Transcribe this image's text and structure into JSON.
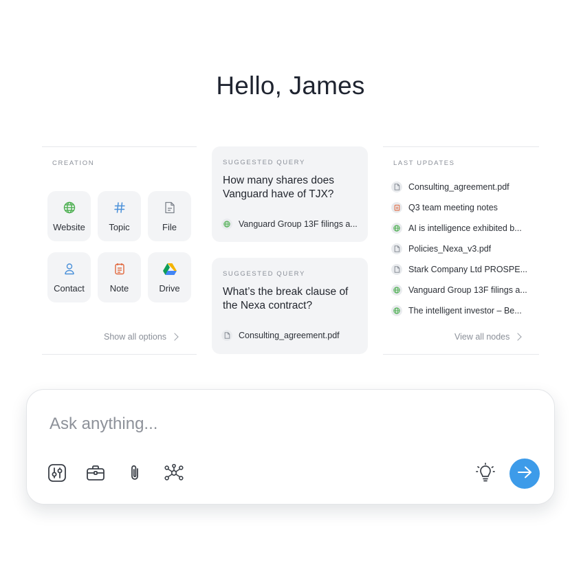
{
  "greeting": "Hello, James",
  "creation": {
    "label": "CREATION",
    "tiles": [
      {
        "label": "Website",
        "icon": "globe-icon"
      },
      {
        "label": "Topic",
        "icon": "hash-icon"
      },
      {
        "label": "File",
        "icon": "file-icon"
      },
      {
        "label": "Contact",
        "icon": "user-icon"
      },
      {
        "label": "Note",
        "icon": "note-icon"
      },
      {
        "label": "Drive",
        "icon": "google-drive-icon"
      }
    ],
    "show_all": "Show all options"
  },
  "suggested": [
    {
      "label": "SUGGESTED QUERY",
      "question": "How many shares does Vanguard have of TJX?",
      "source": "Vanguard Group 13F filings a...",
      "source_icon": "globe-icon"
    },
    {
      "label": "SUGGESTED QUERY",
      "question": "What’s the break clause of the Nexa contract?",
      "source": "Consulting_agreement.pdf",
      "source_icon": "file-icon"
    }
  ],
  "updates": {
    "label": "LAST UPDATES",
    "items": [
      {
        "text": "Consulting_agreement.pdf",
        "icon": "file-icon"
      },
      {
        "text": "Q3 team meeting notes",
        "icon": "note-icon"
      },
      {
        "text": "AI is intelligence exhibited b...",
        "icon": "globe-icon"
      },
      {
        "text": "Policies_Nexa_v3.pdf",
        "icon": "file-icon"
      },
      {
        "text": "Stark Company Ltd PROSPE...",
        "icon": "file-icon"
      },
      {
        "text": "Vanguard Group 13F filings a...",
        "icon": "globe-icon"
      },
      {
        "text": "The intelligent investor – Be...",
        "icon": "globe-icon"
      }
    ],
    "view_all": "View all nodes"
  },
  "chat": {
    "placeholder": "Ask anything...",
    "tools": [
      "sliders-icon",
      "briefcase-icon",
      "paperclip-icon",
      "graph-icon"
    ],
    "idea_icon": "lightbulb-icon",
    "send_icon": "arrow-right-icon"
  },
  "colors": {
    "accent": "#3d9be9",
    "globe": "#4caf50",
    "note": "#e0653a",
    "contact": "#4a90d9",
    "topic": "#4a90d9"
  }
}
